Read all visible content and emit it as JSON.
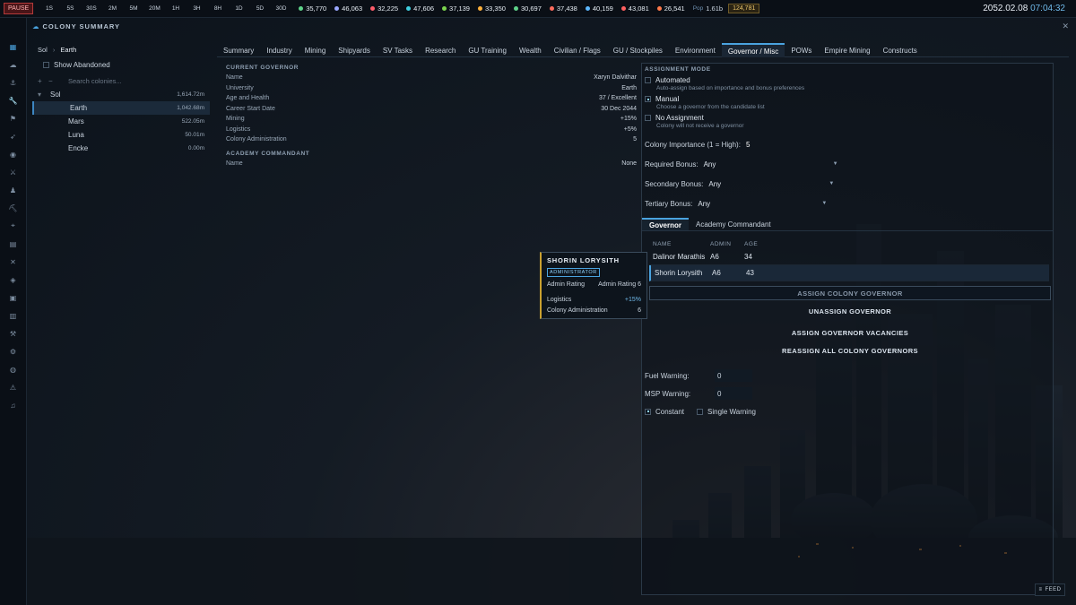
{
  "topbar": {
    "pause_label": "PAUSE",
    "time_buttons": [
      "1S",
      "5S",
      "30S",
      "2M",
      "5M",
      "20M",
      "1H",
      "3H",
      "8H",
      "1D",
      "5D",
      "30D"
    ],
    "resources": [
      {
        "icon": "neutronium-icon",
        "color": "#5fd38a",
        "value": "35,770"
      },
      {
        "icon": "corbomite-icon",
        "color": "#9aa8ff",
        "value": "46,063"
      },
      {
        "icon": "tritanium-icon",
        "color": "#ff5d6a",
        "value": "32,225"
      },
      {
        "icon": "boronide-icon",
        "color": "#3fd0e0",
        "value": "47,606"
      },
      {
        "icon": "uridium-icon",
        "color": "#7bd44e",
        "value": "37,139"
      },
      {
        "icon": "corundium-icon",
        "color": "#ffb13b",
        "value": "33,350"
      },
      {
        "icon": "mercassium-icon",
        "color": "#5fd38a",
        "value": "30,697"
      },
      {
        "icon": "vendarite-icon",
        "color": "#ff6b5d",
        "value": "37,438"
      },
      {
        "icon": "sorium-icon",
        "color": "#5cb8ff",
        "value": "40,159"
      },
      {
        "icon": "gallicite-icon",
        "color": "#ff6060",
        "value": "43,081"
      },
      {
        "icon": "duranium-icon",
        "color": "#ff7a4a",
        "value": "26,541"
      }
    ],
    "pop_label": "Pop",
    "pop_value": "1.61b",
    "wealth_value": "124,781",
    "date": "2052.02.08",
    "time": "07:04:32"
  },
  "sidebar_icons": [
    "grid-icon",
    "fleet-icon",
    "anchor-icon",
    "wrench-icon",
    "flag-icon",
    "rocket-icon",
    "target-icon",
    "crossed-swords-icon",
    "person-icon",
    "pickaxe-icon",
    "telescope-icon",
    "clipboard-icon",
    "close-x-icon",
    "tag-icon",
    "box-icon",
    "document-icon",
    "hammer-icon",
    "gear-icon",
    "planet-icon",
    "warning-icon",
    "music-icon"
  ],
  "window": {
    "title": "COLONY SUMMARY"
  },
  "left": {
    "breadcrumb": [
      "Sol",
      "Earth"
    ],
    "show_abandoned": "Show Abandoned",
    "search_placeholder": "Search colonies...",
    "system": {
      "name": "Sol",
      "value": "1,614.72m"
    },
    "colonies": [
      {
        "name": "Earth",
        "value": "1,042.68m",
        "selected": true
      },
      {
        "name": "Mars",
        "value": "522.05m",
        "selected": false
      },
      {
        "name": "Luna",
        "value": "50.01m",
        "selected": false
      },
      {
        "name": "Encke",
        "value": "0.00m",
        "selected": false
      }
    ]
  },
  "tabs": [
    "Summary",
    "Industry",
    "Mining",
    "Shipyards",
    "SV Tasks",
    "Research",
    "GU Training",
    "Wealth",
    "Civilian / Flags",
    "GU / Stockpiles",
    "Environment",
    "Governor / Misc",
    "POWs",
    "Empire Mining",
    "Constructs"
  ],
  "active_tab": "Governor / Misc",
  "governor": {
    "section_title": "CURRENT GOVERNOR",
    "rows": [
      {
        "k": "Name",
        "v": "Xaryn Dalvithar"
      },
      {
        "k": "University",
        "v": "Earth"
      },
      {
        "k": "Age and Health",
        "v": "37 / Excellent"
      },
      {
        "k": "Career Start Date",
        "v": "30 Dec 2044"
      },
      {
        "k": "Mining",
        "v": "+15%"
      },
      {
        "k": "Logistics",
        "v": "+5%"
      },
      {
        "k": "Colony Administration",
        "v": "5"
      }
    ],
    "academy_title": "ACADEMY COMMANDANT",
    "academy_rows": [
      {
        "k": "Name",
        "v": "None"
      }
    ]
  },
  "assignment": {
    "title": "ASSIGNMENT MODE",
    "modes": [
      {
        "label": "Automated",
        "desc": "Auto-assign based on importance and bonus preferences",
        "checked": false
      },
      {
        "label": "Manual",
        "desc": "Choose a governor from the candidate list",
        "checked": true
      },
      {
        "label": "No Assignment",
        "desc": "Colony will not receive a governor",
        "checked": false
      }
    ],
    "importance_label": "Colony Importance (1 = High):",
    "importance_value": "5",
    "required_label": "Required Bonus:",
    "required_value": "Any",
    "secondary_label": "Secondary Bonus:",
    "secondary_value": "Any",
    "tertiary_label": "Tertiary Bonus:",
    "tertiary_value": "Any",
    "subtabs": [
      "Governor",
      "Academy Commandant"
    ],
    "table_headers": [
      "NAME",
      "ADMIN",
      "AGE"
    ],
    "candidates": [
      {
        "name": "Dalinor Marathis",
        "admin": "A6",
        "age": "34",
        "selected": false
      },
      {
        "name": "Shorin Lorysith",
        "admin": "A6",
        "age": "43",
        "selected": true
      }
    ],
    "btn_assign": "ASSIGN COLONY GOVERNOR",
    "btn_unassign": "UNASSIGN GOVERNOR",
    "btn_vacancies": "ASSIGN GOVERNOR VACANCIES",
    "btn_reassign": "REASSIGN ALL COLONY GOVERNORS",
    "fuel_label": "Fuel Warning:",
    "fuel_value": "0",
    "msp_label": "MSP Warning:",
    "msp_value": "0",
    "constant_label": "Constant",
    "single_label": "Single Warning"
  },
  "tooltip": {
    "name": "SHORIN LORYSITH",
    "badge": "ADMINISTRATOR",
    "rows": [
      {
        "k": "Admin Rating",
        "v": "Admin Rating 6"
      },
      {
        "k": "Logistics",
        "v": "+15%"
      },
      {
        "k": "Colony Administration",
        "v": "6"
      }
    ]
  },
  "feed_label": "FEED"
}
